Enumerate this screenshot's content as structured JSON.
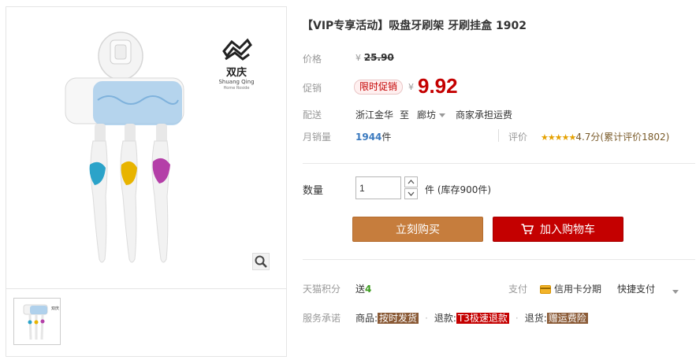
{
  "product": {
    "title": "【VIP专享活动】吸盘牙刷架 牙刷挂盒 1902",
    "brand_cn": "双庆",
    "brand_en": "Shuang Qing",
    "brand_sub": "Home Roside"
  },
  "price": {
    "label": "价格",
    "yen": "¥",
    "original": "25.90"
  },
  "promo": {
    "label": "促销",
    "tag": "限时促销",
    "yen": "¥",
    "price": "9.92"
  },
  "delivery": {
    "label": "配送",
    "from": "浙江金华",
    "to_word": "至",
    "to_city": "廊坊",
    "shipping": "商家承担运费"
  },
  "sales": {
    "label": "月销量",
    "count": "1944",
    "unit": "件"
  },
  "rating": {
    "label": "评价",
    "stars": "★★★★★",
    "score": "4.7分",
    "total": "(累计评价1802)"
  },
  "quantity": {
    "label": "数量",
    "value": "1",
    "unit_stock": "件 (库存900件)"
  },
  "buttons": {
    "buy": "立刻购买",
    "cart": "加入购物车"
  },
  "points": {
    "label": "天猫积分",
    "send": "送",
    "amount": "4"
  },
  "payment": {
    "label": "支付",
    "credit": "信用卡分期",
    "quick": "快捷支付"
  },
  "service": {
    "label": "服务承诺",
    "items": [
      {
        "prefix": "商品:",
        "badge": "按时发货"
      },
      {
        "prefix": "退款:",
        "badge": "T3极速退款"
      },
      {
        "prefix": "退货:",
        "badge": "赠运费险"
      }
    ]
  },
  "colors": {
    "accent_red": "#c40000",
    "buy_orange": "#c67d3d",
    "handle_teal": "#2ba3c9",
    "handle_yellow": "#e8b400",
    "handle_purple": "#b43fa8",
    "case_blue": "#9fc8ea"
  }
}
